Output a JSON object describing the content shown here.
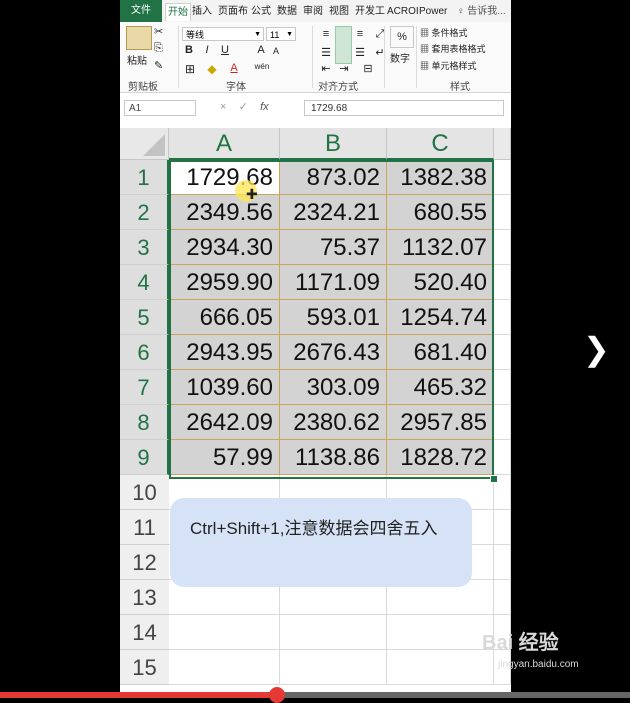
{
  "ribbon": {
    "tabs": [
      "文件",
      "开始",
      "插入",
      "页面布",
      "公式",
      "数据",
      "审阅",
      "视图",
      "开发工",
      "ACROI",
      "Power"
    ],
    "tell_me": "告诉我...",
    "clipboard": {
      "paste": "粘贴",
      "label": "剪贴板"
    },
    "font": {
      "name": "等线",
      "size": "11",
      "bold": "B",
      "italic": "I",
      "underline": "U",
      "grow": "A",
      "shrink": "A",
      "color_a": "A",
      "wen": "wén",
      "label": "字体"
    },
    "alignment": {
      "label": "对齐方式"
    },
    "number": {
      "percent": "%",
      "label": "数字"
    },
    "styles": {
      "conditional": "条件格式",
      "table": "套用表格格式",
      "cell": "单元格样式",
      "label": "样式"
    }
  },
  "formula_bar": {
    "name_box": "A1",
    "cancel": "×",
    "enter": "✓",
    "fx": "fx",
    "value": "1729.68"
  },
  "grid": {
    "columns": [
      "A",
      "B",
      "C"
    ],
    "rows": [
      "1",
      "2",
      "3",
      "4",
      "5",
      "6",
      "7",
      "8",
      "9",
      "10",
      "11",
      "12",
      "13",
      "14",
      "15"
    ],
    "cells": [
      [
        "1729.68",
        "873.02",
        "1382.38"
      ],
      [
        "2349.56",
        "2324.21",
        "680.55"
      ],
      [
        "2934.30",
        "75.37",
        "1132.07"
      ],
      [
        "2959.90",
        "1171.09",
        "520.40"
      ],
      [
        "666.05",
        "593.01",
        "1254.74"
      ],
      [
        "2943.95",
        "2676.43",
        "681.40"
      ],
      [
        "1039.60",
        "303.09",
        "465.32"
      ],
      [
        "2642.09",
        "2380.62",
        "2957.85"
      ],
      [
        "57.99",
        "1138.86",
        "1828.72"
      ]
    ]
  },
  "annotation": "Ctrl+Shift+1,注意数据会四舍五入",
  "watermark": {
    "brand": "Bai 经验",
    "url": "jingyan.baidu.com"
  },
  "video": {
    "progress_fraction": 0.44
  }
}
